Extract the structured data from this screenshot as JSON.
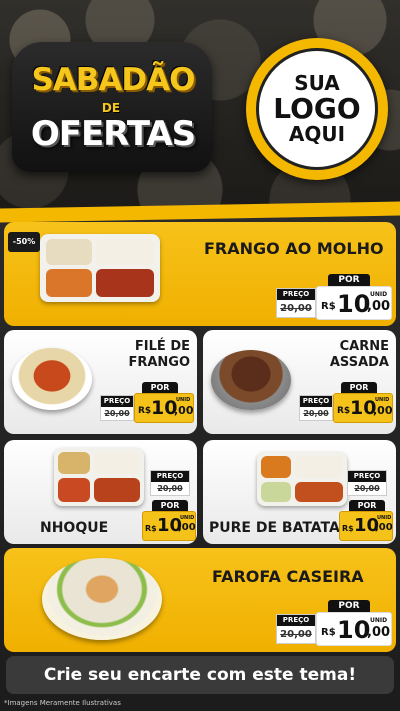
{
  "header": {
    "title_line1": "SABADÃO",
    "title_de": "DE",
    "title_line2": "OFERTAS",
    "logo_line1": "SUA",
    "logo_line2": "LOGO",
    "logo_line3": "AQUI"
  },
  "badge": {
    "discount": "-50%"
  },
  "labels": {
    "por": "POR",
    "preco": "PREÇO",
    "rs": "R$",
    "unid": "UNID"
  },
  "products": [
    {
      "name": "FRANGO AO MOLHO",
      "old_price": "20,00",
      "price_int": "10",
      "price_dec": ",00"
    },
    {
      "name_line1": "FILÉ DE",
      "name_line2": "FRANGO",
      "old_price": "20,00",
      "price_int": "10",
      "price_dec": ",00"
    },
    {
      "name_line1": "CARNE",
      "name_line2": "ASSADA",
      "old_price": "20,00",
      "price_int": "10",
      "price_dec": ",00"
    },
    {
      "name": "NHOQUE",
      "old_price": "20,00",
      "price_int": "10",
      "price_dec": ",00"
    },
    {
      "name": "PURE DE BATATA",
      "old_price": "20,00",
      "price_int": "10",
      "price_dec": ",00"
    },
    {
      "name": "FAROFA CASEIRA",
      "old_price": "20,00",
      "price_int": "10",
      "price_dec": ",00"
    }
  ],
  "footer": {
    "cta": "Crie seu encarte com este tema!",
    "disclaimer": "*Imagens Meramente Ilustrativas"
  },
  "colors": {
    "accent_yellow": "#f5b800",
    "dark": "#1a1a1a",
    "card_white": "#ffffff"
  }
}
